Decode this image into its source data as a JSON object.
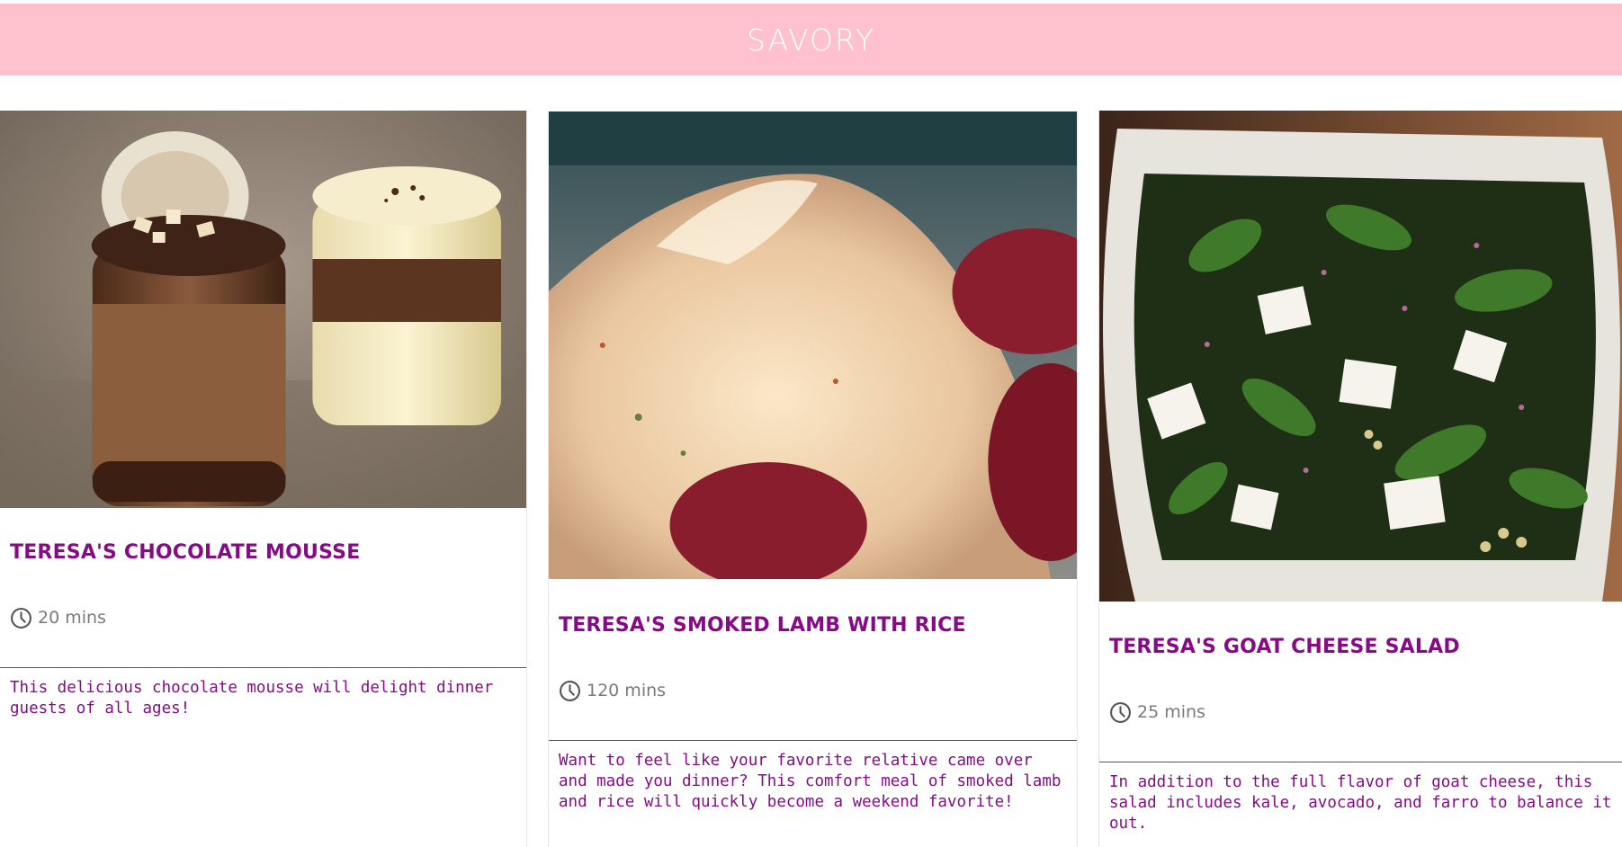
{
  "banner": {
    "title": "SAVORY"
  },
  "cards": [
    {
      "title": "TERESA'S CHOCOLATE MOUSSE",
      "time": "20 mins",
      "description": "This delicious chocolate mousse will delight dinner guests of all ages!",
      "image": "chocolate-mousse-photo"
    },
    {
      "title": "TERESA'S SMOKED LAMB WITH RICE",
      "time": "120 mins",
      "description": "Want to feel like your favorite relative came over and made you dinner? This comfort meal of smoked lamb and rice will quickly become a weekend favorite!",
      "image": "lamb-rice-photo"
    },
    {
      "title": "TERESA'S GOAT CHEESE SALAD",
      "time": "25 mins",
      "description": "In addition to the full flavor of goat cheese, this salad includes kale, avocado, and farro to balance it out.",
      "image": "goat-cheese-salad-photo"
    }
  ],
  "colors": {
    "banner": "#fec1cd",
    "title": "#850c85",
    "time": "#7a7a7a"
  }
}
